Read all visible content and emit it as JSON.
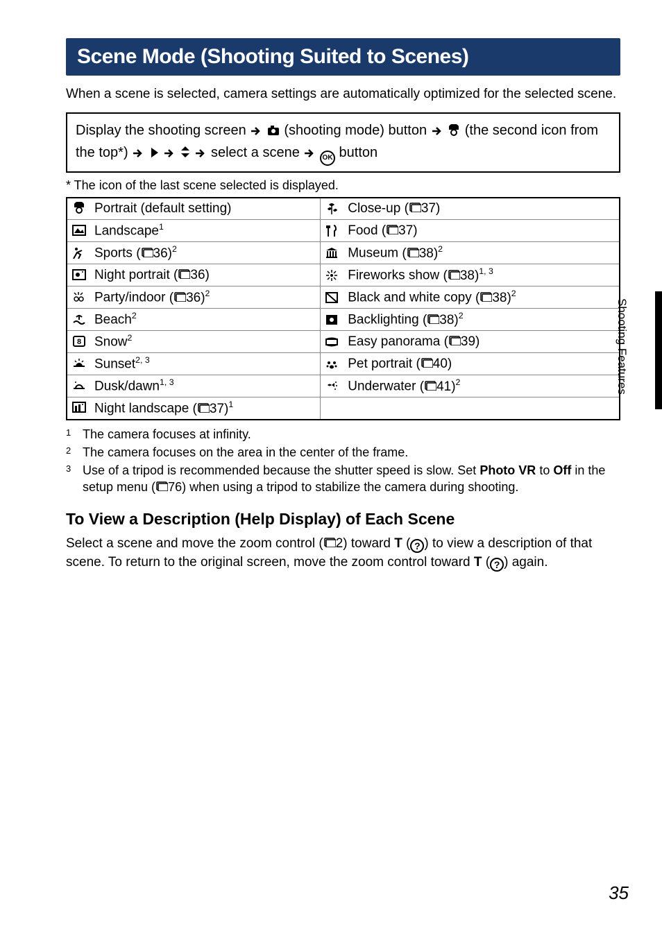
{
  "title": "Scene Mode (Shooting Suited to Scenes)",
  "intro": "When a scene is selected, camera settings are automatically optimized for the selected scene.",
  "nav": {
    "prefix": "Display the shooting screen",
    "shooting_mode": "(shooting mode) button",
    "second_icon": "(the second icon from the top*)",
    "select_scene": "select a scene",
    "button_word": "button"
  },
  "asterisk": "*  The icon of the last scene selected is displayed.",
  "scenes_left": [
    {
      "label": "Portrait (default setting)",
      "ref": "",
      "sup": ""
    },
    {
      "label": "Landscape",
      "ref": "",
      "sup": "1"
    },
    {
      "label": "Sports",
      "ref": "36",
      "sup": "2"
    },
    {
      "label": "Night portrait",
      "ref": "36",
      "sup": ""
    },
    {
      "label": "Party/indoor",
      "ref": "36",
      "sup": "2"
    },
    {
      "label": "Beach",
      "ref": "",
      "sup": "2"
    },
    {
      "label": "Snow",
      "ref": "",
      "sup": "2"
    },
    {
      "label": "Sunset",
      "ref": "",
      "sup": "2, 3"
    },
    {
      "label": "Dusk/dawn",
      "ref": "",
      "sup": "1, 3"
    },
    {
      "label": "Night landscape",
      "ref": "37",
      "sup": "1"
    }
  ],
  "scenes_right": [
    {
      "label": "Close-up",
      "ref": "37",
      "sup": ""
    },
    {
      "label": "Food",
      "ref": "37",
      "sup": ""
    },
    {
      "label": "Museum",
      "ref": "38",
      "sup": "2"
    },
    {
      "label": "Fireworks show",
      "ref": "38",
      "sup": "1, 3"
    },
    {
      "label": "Black and white copy",
      "ref": "38",
      "sup": "2"
    },
    {
      "label": "Backlighting",
      "ref": "38",
      "sup": "2"
    },
    {
      "label": "Easy panorama",
      "ref": "39",
      "sup": ""
    },
    {
      "label": "Pet portrait",
      "ref": "40",
      "sup": ""
    },
    {
      "label": "Underwater",
      "ref": "41",
      "sup": "2"
    },
    {
      "label": "",
      "ref": "",
      "sup": ""
    }
  ],
  "footnotes": {
    "1": "The camera focuses at infinity.",
    "2": "The camera focuses on the area in the center of the frame.",
    "3a": "Use of a tripod is recommended because the shutter speed is slow. Set ",
    "3bold1": "Photo VR",
    "3b": " to ",
    "3bold2": "Off",
    "3c": " in the setup menu (",
    "3ref": "76",
    "3d": ") when using a tripod to stabilize the camera during shooting."
  },
  "help": {
    "heading": "To View a Description (Help Display) of Each Scene",
    "p1": "Select a scene and move the zoom control (",
    "ref1": "2",
    "p2": ") toward ",
    "T": "T",
    "p3": " (",
    "p4": ") to view a description of that scene. To return to the original screen, move the zoom control toward ",
    "p5": " (",
    "p6": ") again."
  },
  "side_tab": "Shooting Features",
  "page_number": "35"
}
